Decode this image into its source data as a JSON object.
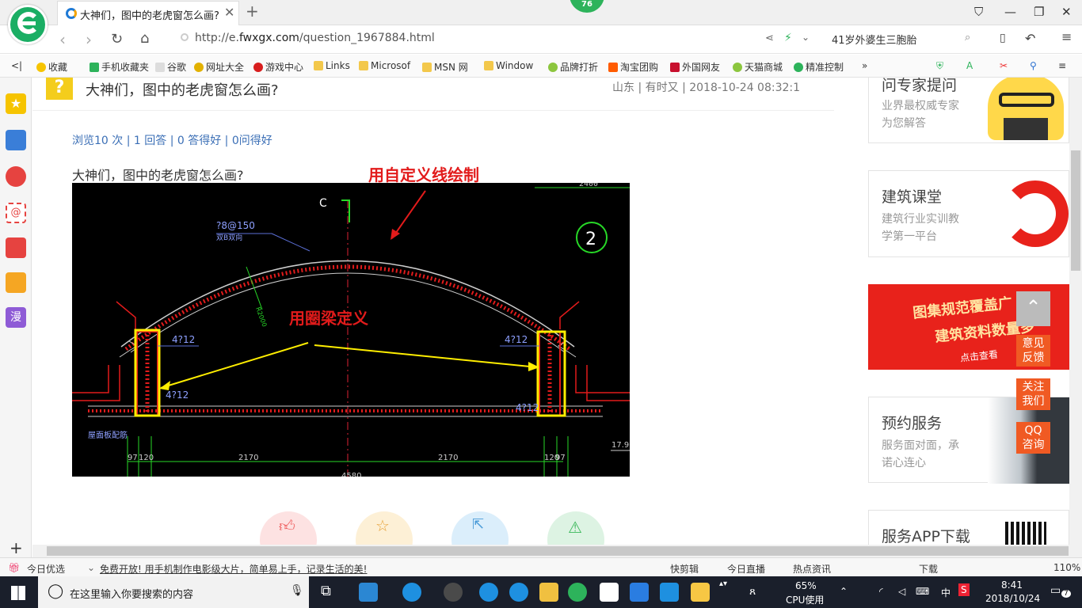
{
  "browser": {
    "badge": "76",
    "tab_title": "大神们，图中的老虎窗怎么画? _",
    "url_prefix": "http://e.",
    "url_domain": "fwxgx.com",
    "url_path": "/question_1967884.html",
    "search_text": "41岁外婆生三胞胎"
  },
  "bookmarks": [
    "收藏",
    "手机收藏夹",
    "谷歌",
    "网址大全",
    "游戏中心",
    "Links",
    "Microsof",
    "MSN 网",
    "Window",
    "品牌打折",
    "淘宝团购",
    "外国网友",
    "天猫商城",
    "精准控制"
  ],
  "question": {
    "icon": "?",
    "title": "大神们，图中的老虎窗怎么画?",
    "meta": "山东 | 有时又 | 2018-10-24 08:32:1",
    "stats": "浏览10 次 | 1 回答 | 0 答得好 | 0问得好",
    "body": "大神们，图中的老虎窗怎么画?"
  },
  "drawing": {
    "annotation_top": "用自定义线绘制",
    "annotation_mid": "用圈梁定义",
    "axis_label": "C",
    "circle_label": "2",
    "rebar_label": "?8@150",
    "rebar_sub": "双B双向",
    "radius_label": "R2000",
    "col_left_top": "4?12",
    "col_left_bottom": "4?12",
    "col_right_top": "4?12",
    "col_right_bottom": "4?12",
    "slab_label": "屋面板配筋",
    "dim_left_small": "97",
    "dim_left_small2": "120",
    "dim_left": "2170",
    "dim_right": "2170",
    "dim_right_small": "120",
    "dim_right_small2": "97",
    "dim_bottom": "4580",
    "dim_top": "2400",
    "elev": "17.90"
  },
  "right_cards": [
    {
      "title": "问专家提问",
      "sub1": "业界最权威专家",
      "sub2": "为您解答"
    },
    {
      "title": "建筑课堂",
      "sub1": "建筑行业实训教",
      "sub2": "学第一平台"
    },
    {
      "title": "图集规范覆盖广",
      "sub1": "建筑资料数量多",
      "sub2": "点击查看"
    },
    {
      "title": "预约服务",
      "sub1": "服务面对面，承",
      "sub2": "诺心连心"
    },
    {
      "title": "服务APP下载",
      "sub1": "",
      "sub2": ""
    }
  ],
  "float_buttons": [
    "意见\n反馈",
    "关注\n我们",
    "QQ\n咨询"
  ],
  "status_bar": {
    "left": "今日优选",
    "news": "免费开放! 用手机制作电影级大片，简单易上手，记录生活的美!",
    "items": [
      "快剪辑",
      "今日直播",
      "热点资讯",
      "下载"
    ],
    "zoom": "110%"
  },
  "taskbar": {
    "search_placeholder": "在这里输入你要搜索的内容",
    "cpu": "65%",
    "cpu_label": "CPU使用",
    "ime": "中",
    "time": "8:41",
    "date": "2018/10/24",
    "notifications": "7"
  }
}
